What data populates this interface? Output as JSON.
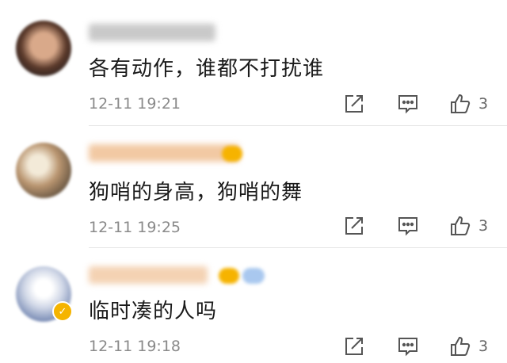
{
  "comments": [
    {
      "text": "各有动作，谁都不打扰谁",
      "time": "12-11 19:21",
      "likes": "3"
    },
    {
      "text": "狗哨的身高，狗哨的舞",
      "time": "12-11 19:25",
      "likes": "3"
    },
    {
      "text": "临时凑的人吗",
      "time": "12-11 19:18",
      "likes": "3"
    }
  ],
  "icons": {
    "share": "share-icon",
    "comment": "comment-icon",
    "like": "like-icon",
    "verified": "verified-badge-icon"
  },
  "colors": {
    "text": "#1a1a1a",
    "meta": "#8a8a8a",
    "icon": "#555555",
    "badge": "#f5b400"
  }
}
